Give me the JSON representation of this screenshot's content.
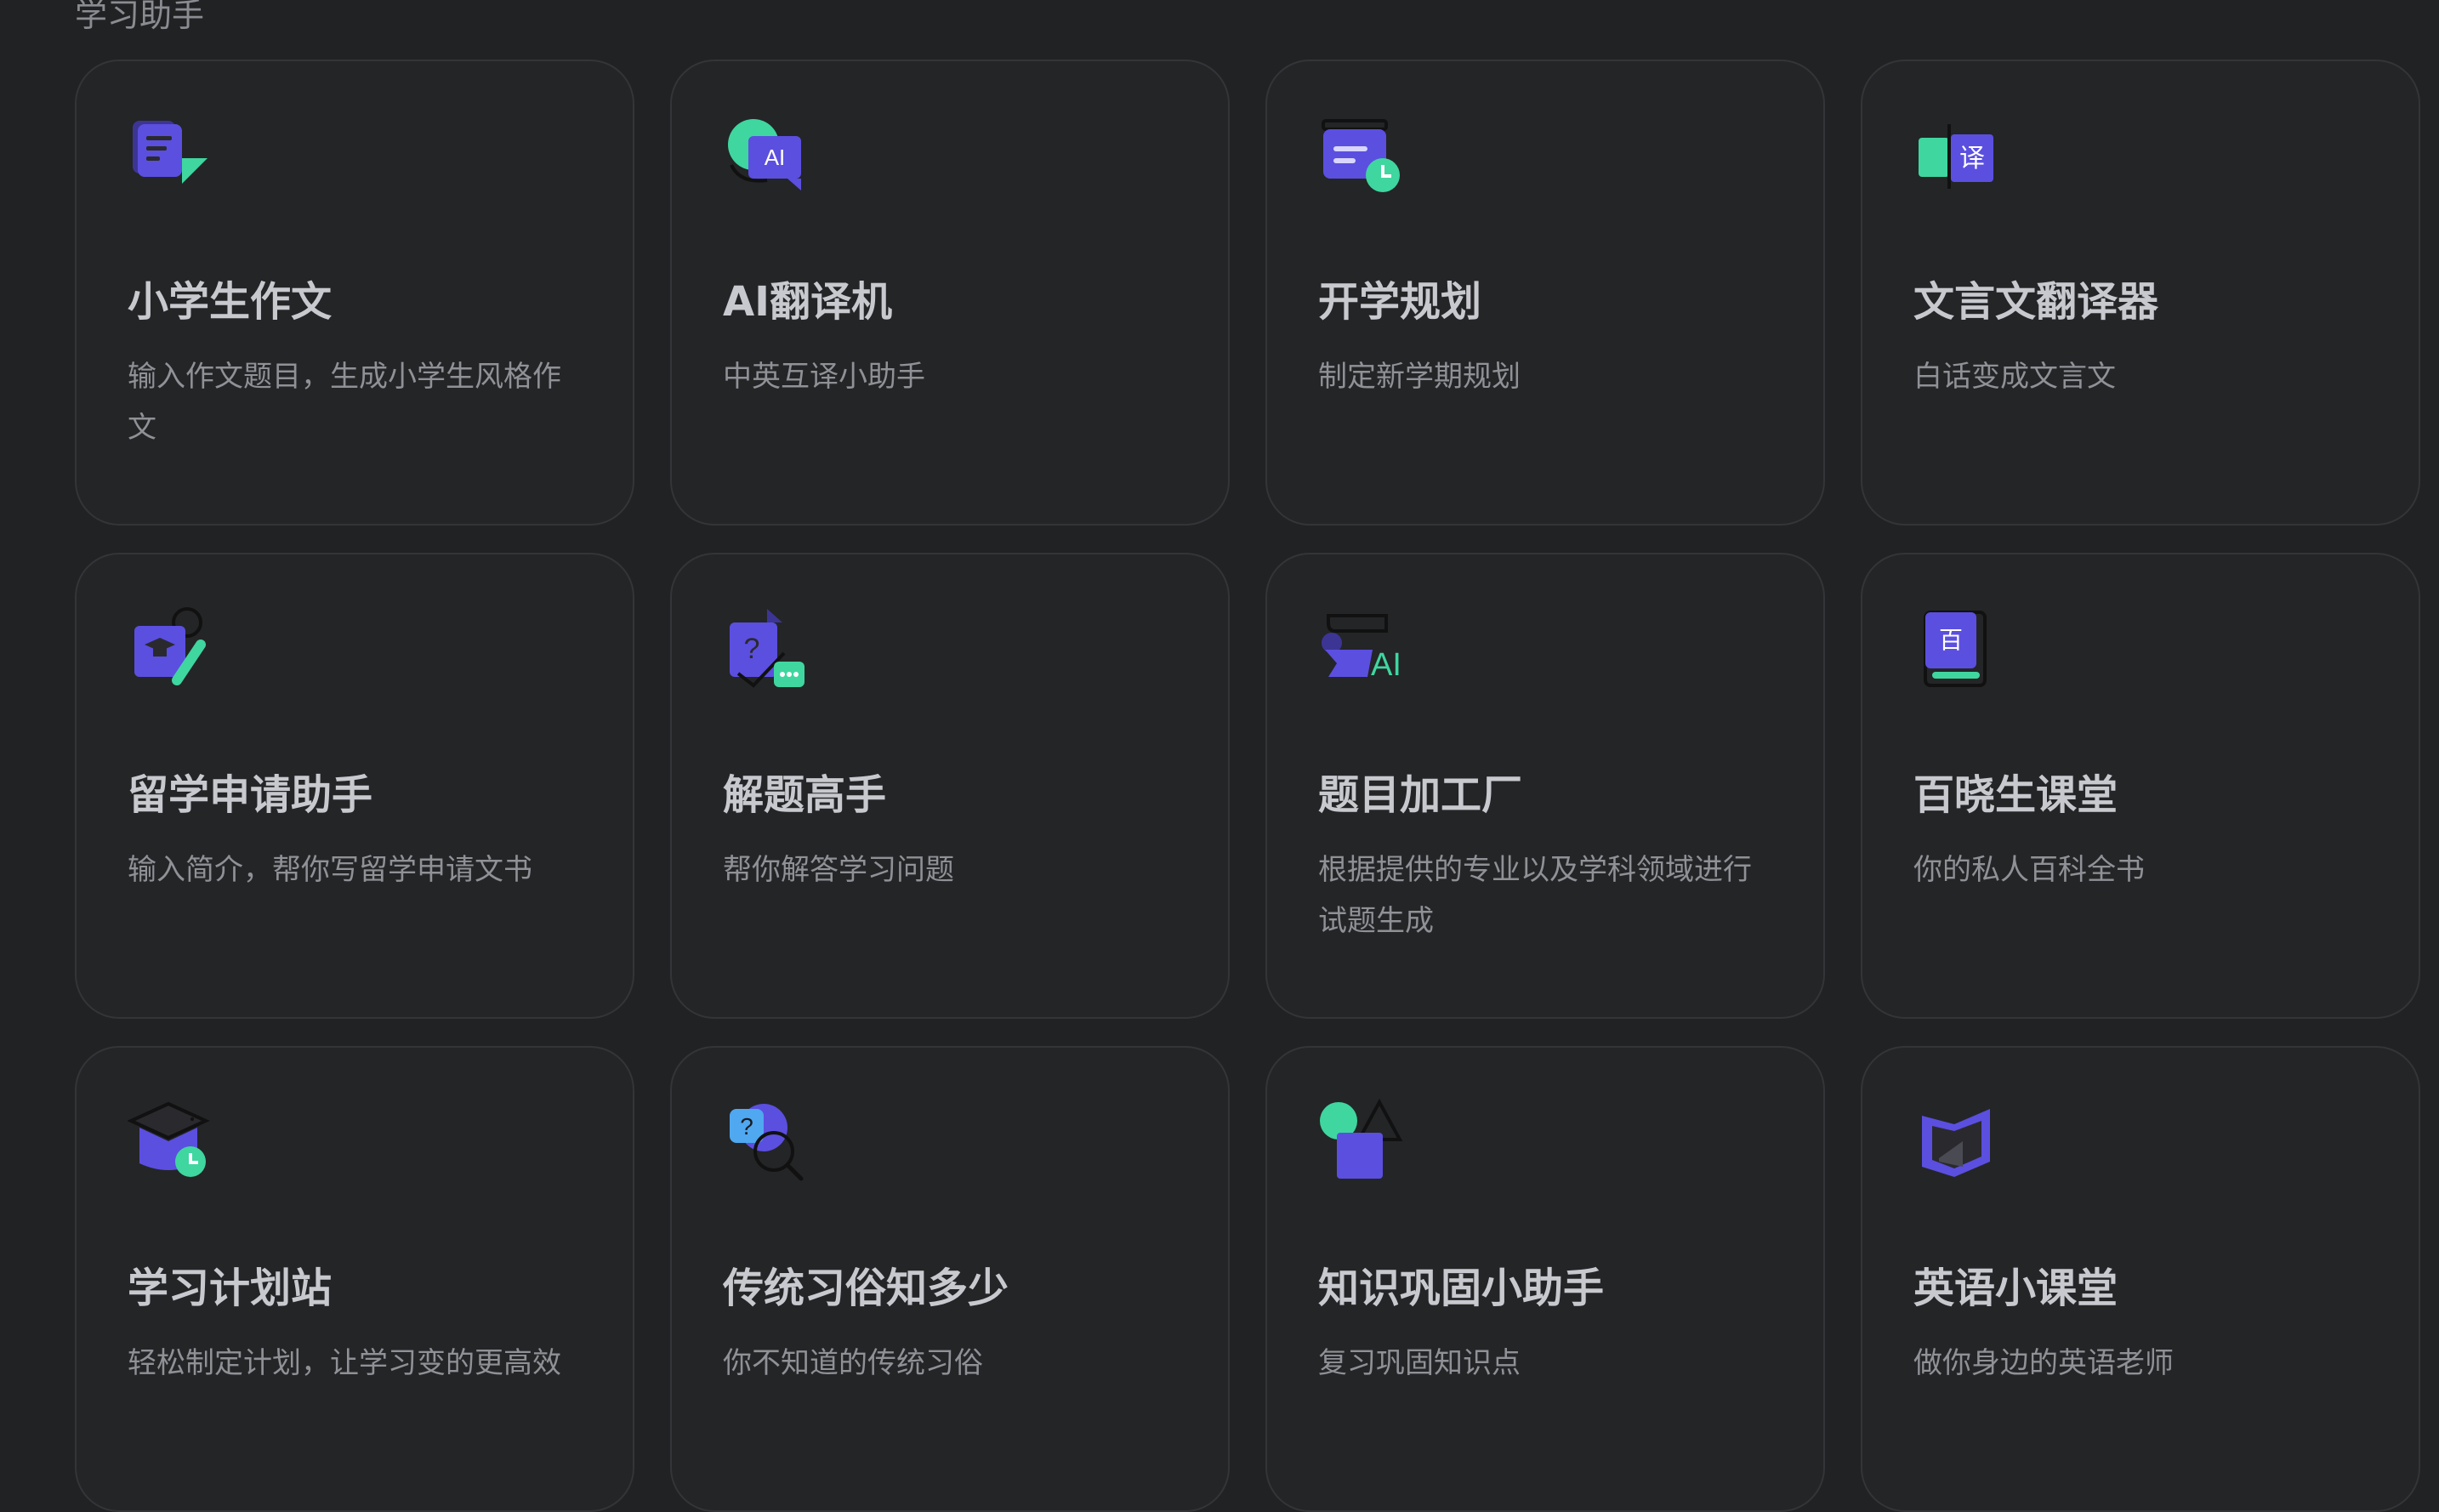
{
  "section": {
    "title": "学习助手"
  },
  "cards": [
    {
      "title": "小学生作文",
      "desc": "输入作文题目，生成小学生风格作文",
      "icon": "essay-icon"
    },
    {
      "title": "AI翻译机",
      "desc": "中英互译小助手",
      "icon": "ai-translate-icon",
      "icon_text": "AI"
    },
    {
      "title": "开学规划",
      "desc": "制定新学期规划",
      "icon": "calendar-plan-icon"
    },
    {
      "title": "文言文翻译器",
      "desc": "白话变成文言文",
      "icon": "classical-translate-icon",
      "icon_text": "译"
    },
    {
      "title": "留学申请助手",
      "desc": "输入简介，帮你写留学申请文书",
      "icon": "study-abroad-icon"
    },
    {
      "title": "解题高手",
      "desc": "帮你解答学习问题",
      "icon": "problem-solver-icon",
      "icon_text": "?"
    },
    {
      "title": "题目加工厂",
      "desc": "根据提供的专业以及学科领域进行试题生成",
      "icon": "question-factory-icon",
      "icon_text": "AI"
    },
    {
      "title": "百晓生课堂",
      "desc": "你的私人百科全书",
      "icon": "encyclopedia-book-icon",
      "icon_text": "百"
    },
    {
      "title": "学习计划站",
      "desc": "轻松制定计划，让学习变的更高效",
      "icon": "study-plan-icon"
    },
    {
      "title": "传统习俗知多少",
      "desc": "你不知道的传统习俗",
      "icon": "tradition-quiz-icon",
      "icon_text": "?"
    },
    {
      "title": "知识巩固小助手",
      "desc": "复习巩固知识点",
      "icon": "shapes-knowledge-icon"
    },
    {
      "title": "英语小课堂",
      "desc": "做你身边的英语老师",
      "icon": "open-book-icon"
    }
  ],
  "colors": {
    "purple": "#5b4fe0",
    "green": "#3fd6a0",
    "background": "#212223",
    "card": "#242527"
  }
}
